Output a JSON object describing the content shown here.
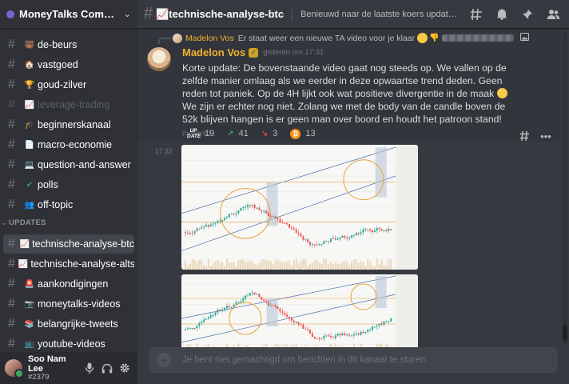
{
  "server": {
    "name": "MoneyTalks Communi..."
  },
  "channels": [
    {
      "name": "de-beurs",
      "icon": "bear-emoji",
      "color": "#c0874a",
      "glyph": "🐻",
      "muted": false
    },
    {
      "name": "vastgoed",
      "icon": "house-emoji",
      "color": "#d0a36e",
      "glyph": "🏠",
      "muted": false
    },
    {
      "name": "goud-zilver",
      "icon": "trophy-emoji",
      "color": "#f0b232",
      "glyph": "🏆",
      "muted": false
    },
    {
      "name": "leverage-trading",
      "icon": "chart-emoji",
      "color": "#e8e8e8",
      "glyph": "📈",
      "muted": true
    },
    {
      "name": "beginnerskanaal",
      "icon": "graduation-cap-emoji",
      "color": "#222",
      "glyph": "🎓",
      "muted": false
    },
    {
      "name": "macro-economie",
      "icon": "document-emoji",
      "color": "#f2f2f2",
      "glyph": "📄",
      "muted": false
    },
    {
      "name": "question-and-answer",
      "icon": "computer-emoji",
      "color": "#5fa8d3",
      "glyph": "💻",
      "muted": false
    },
    {
      "name": "polls",
      "icon": "checkmark-emoji",
      "color": "#3ba55d",
      "glyph": "✔",
      "muted": false
    },
    {
      "name": "off-topic",
      "icon": "people-emoji",
      "color": "#3a3a3a",
      "glyph": "👥",
      "muted": false
    }
  ],
  "category": {
    "label": "UPDATES"
  },
  "update_channels": [
    {
      "name": "technische-analyse-btc",
      "icon": "chart-emoji",
      "glyph": "📈",
      "color": "#f2f2f2",
      "active": true
    },
    {
      "name": "technische-analyse-alts",
      "icon": "chart-emoji",
      "glyph": "📈",
      "color": "#f2f2f2",
      "active": false
    },
    {
      "name": "aankondigingen",
      "icon": "siren-emoji",
      "glyph": "🚨",
      "color": "#ed4245",
      "active": false
    },
    {
      "name": "moneytalks-videos",
      "icon": "camera-emoji",
      "glyph": "📷",
      "color": "#3a3a3a",
      "active": false
    },
    {
      "name": "belangrijke-tweets",
      "icon": "books-emoji",
      "glyph": "📚",
      "color": "#c0874a",
      "active": false
    },
    {
      "name": "youtube-videos",
      "icon": "tv-emoji",
      "glyph": "📺",
      "color": "#5fa8d3",
      "active": false
    }
  ],
  "user": {
    "name": "Soo Nam Lee",
    "tag": "#2379"
  },
  "topbar": {
    "channel": "📈technische-analyse-btc",
    "topic": "Benieuwd naar de laatste koers update? Die vi..."
  },
  "message": {
    "reply_author": "Madelon Vos",
    "reply_text": "Er staat weer een nieuwe TA video voor je klaar",
    "author": "Madelon Vos",
    "timestamp": "gisteren om 17:31",
    "text_1": "Korte update: De bovenstaande video gaat nog steeds op. We vallen op de zelfde manier omlaag als we eerder in deze opwaartse trend deden. Geen reden tot paniek. Op de 4H lijkt ook wat positieve divergentie in de maak ",
    "text_2": " We zijn er echter nog niet. Zolang we met de body van de candle boven de 52k blijven hangen is er geen man over boord en houdt het patroon stand!",
    "edited": "(bewerkt)",
    "reactions": [
      {
        "emoji": "UP DATE",
        "icon": "update-emoji",
        "color": "#ffffff",
        "count": "19"
      },
      {
        "emoji": "↗",
        "icon": "chart-up-emoji",
        "color": "#3ba55d",
        "count": "41"
      },
      {
        "emoji": "↘",
        "icon": "chart-down-emoji",
        "color": "#ed4245",
        "count": "3"
      },
      {
        "emoji": "₿",
        "icon": "bitcoin-emoji",
        "color": "#f7931a",
        "count": "13"
      }
    ],
    "attachment_time": "17:32"
  },
  "composer": {
    "placeholder": "Je bent niet gemachtigd om berichten in dit kanaal te sturen."
  }
}
